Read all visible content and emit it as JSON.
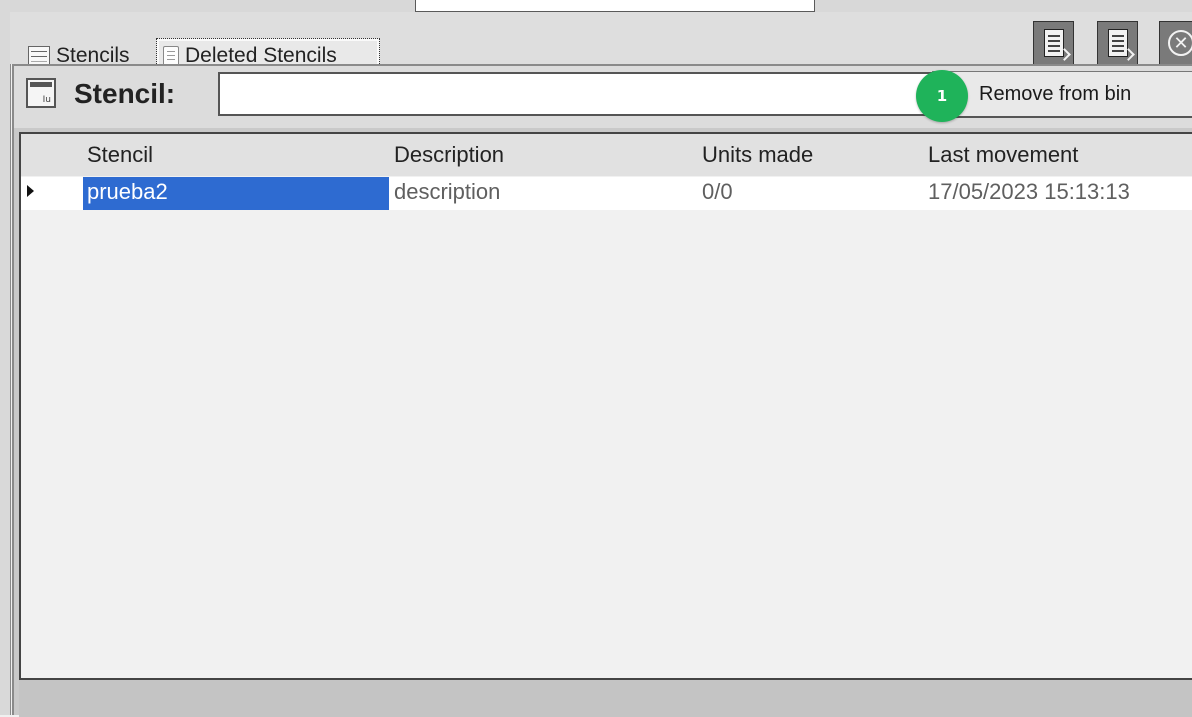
{
  "tabs": [
    {
      "label": "Stencils",
      "icon": "list-icon",
      "active": false
    },
    {
      "label": "Deleted Stencils",
      "icon": "bin-icon",
      "active": true
    }
  ],
  "toolbar": {
    "buttons": [
      {
        "icon": "document-export-icon"
      },
      {
        "icon": "document-import-icon"
      },
      {
        "icon": "close-icon",
        "glyph": "✕"
      }
    ]
  },
  "stencil_filter": {
    "label": "Stencil:",
    "value": "",
    "placeholder": ""
  },
  "remove_button": {
    "label": "Remove from bin"
  },
  "step_badge": {
    "text": "1",
    "color": "#1fb35a"
  },
  "grid": {
    "columns": [
      "Stencil",
      "Description",
      "Units made",
      "Last movement"
    ],
    "rows": [
      {
        "stencil": "prueba2",
        "description": "description",
        "units_made": "0/0",
        "last_movement": "17/05/2023 15:13:13",
        "selected": true
      }
    ]
  },
  "colors": {
    "selection": "#2e6bd1",
    "toolbar_button": "#7a7a7a",
    "badge": "#1fb35a"
  }
}
